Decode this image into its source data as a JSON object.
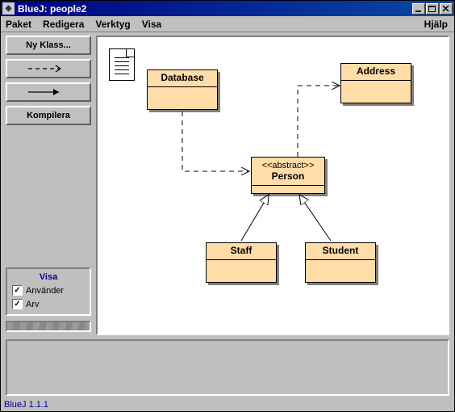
{
  "title": "BlueJ:  people2",
  "menus": {
    "paket": "Paket",
    "redigera": "Redigera",
    "verktyg": "Verktyg",
    "visa": "Visa",
    "help": "Hjälp"
  },
  "sidebar": {
    "new_class": "Ny Klass...",
    "compile": "Kompilera"
  },
  "visa": {
    "title": "Visa",
    "uses": "Använder",
    "inherits": "Arv"
  },
  "classes": {
    "database": {
      "name": "Database"
    },
    "address": {
      "name": "Address"
    },
    "person": {
      "name": "Person",
      "stereotype": "<<abstract>>"
    },
    "staff": {
      "name": "Staff"
    },
    "student": {
      "name": "Student"
    }
  },
  "footer": "BlueJ 1.1.1"
}
